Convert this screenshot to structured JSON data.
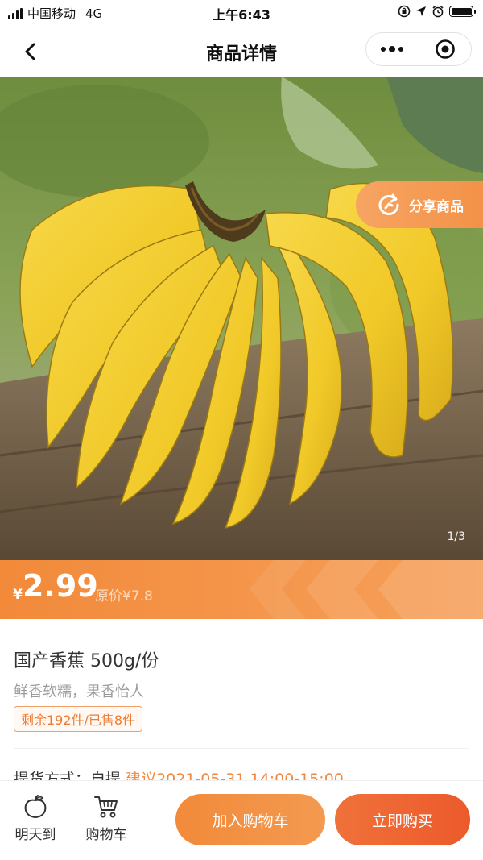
{
  "status_bar": {
    "carrier": "中国移动",
    "network": "4G",
    "time": "上午6:43"
  },
  "nav": {
    "title": "商品详情"
  },
  "gallery": {
    "share_label": "分享商品",
    "pager": "1/3",
    "image_icon": "banana-photo"
  },
  "price": {
    "currency": "¥",
    "value": "2.99",
    "original": "原价¥7.8"
  },
  "product": {
    "title": "国产香蕉 500g/份",
    "subtitle": "鲜香软糯，果香怡人",
    "stock_tag": "剩余192件/已售8件",
    "pickup_label": "提货方式：自提",
    "pickup_time": "建议2021-05-31 14:00-15:00"
  },
  "bottom_bar": {
    "tomorrow_label": "明天到",
    "cart_label": "购物车",
    "add_to_cart": "加入购物车",
    "buy_now": "立即购买"
  },
  "colors": {
    "accent": "#f28a3a",
    "buy": "#ec5a2b"
  }
}
